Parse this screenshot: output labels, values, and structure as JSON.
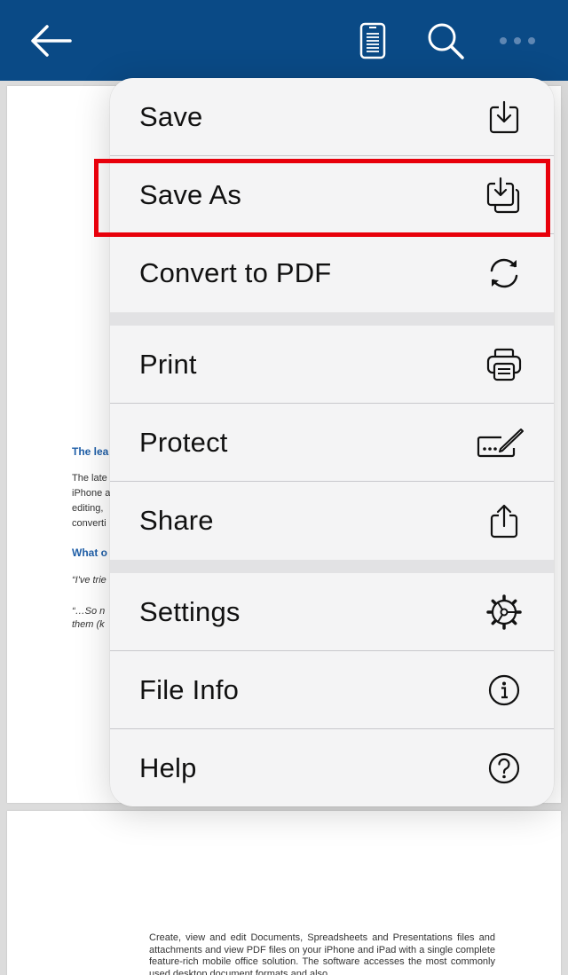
{
  "toolbar": {
    "back_icon": "arrow-left-icon",
    "reader_icon": "phone-document-icon",
    "search_icon": "magnifier-icon",
    "more_icon": "ellipsis-icon"
  },
  "document": {
    "heading1": "The lea",
    "body_lines": [
      "The late",
      "iPhone a",
      "editing,",
      "converti"
    ],
    "heading2": "What o",
    "quote1": "“I've trie",
    "quote2_lines": [
      "“…So n",
      "them (k"
    ],
    "page2_paragraph": "Create, view and edit Documents, Spreadsheets and Presentations files and attachments and view PDF files on your iPhone and iPad with a single complete feature-rich mobile office solution. The software accesses the most commonly used desktop document formats and also"
  },
  "menu": {
    "items": [
      {
        "label": "Save",
        "icon": "save-download-icon"
      },
      {
        "label": "Save As",
        "icon": "save-as-icon"
      },
      {
        "label": "Convert to PDF",
        "icon": "convert-arrows-icon"
      },
      {
        "label": "Print",
        "icon": "printer-icon"
      },
      {
        "label": "Protect",
        "icon": "signature-pen-icon"
      },
      {
        "label": "Share",
        "icon": "share-icon"
      },
      {
        "label": "Settings",
        "icon": "gear-icon"
      },
      {
        "label": "File Info",
        "icon": "info-icon"
      },
      {
        "label": "Help",
        "icon": "help-icon"
      }
    ]
  },
  "colors": {
    "toolbar_bg": "#0a4a86",
    "highlight_border": "#e8000b",
    "doc_heading": "#1f5fa8"
  }
}
